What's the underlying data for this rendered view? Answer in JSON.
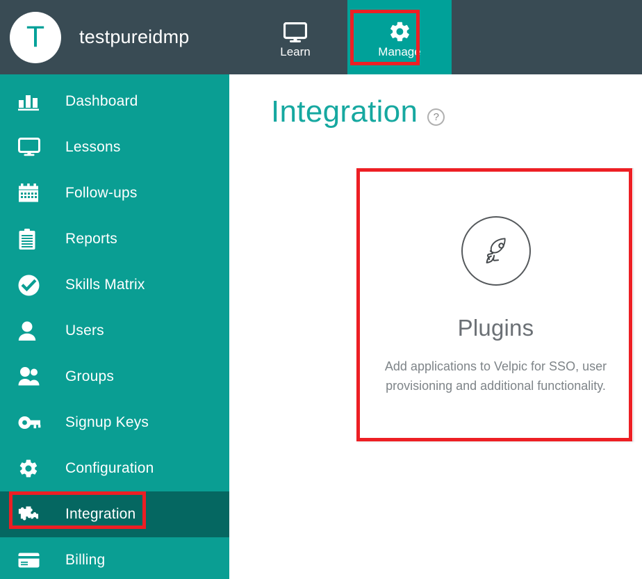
{
  "topbar": {
    "avatar_letter": "T",
    "account_name": "testpureidmp",
    "nav": [
      {
        "label": "Learn",
        "icon": "monitor-icon",
        "active": false
      },
      {
        "label": "Manage",
        "icon": "gear-icon",
        "active": true
      }
    ]
  },
  "sidebar": {
    "items": [
      {
        "label": "Dashboard",
        "icon": "bar-chart-icon",
        "active": false
      },
      {
        "label": "Lessons",
        "icon": "monitor-icon",
        "active": false
      },
      {
        "label": "Follow-ups",
        "icon": "calendar-icon",
        "active": false
      },
      {
        "label": "Reports",
        "icon": "clipboard-icon",
        "active": false
      },
      {
        "label": "Skills Matrix",
        "icon": "check-circle-icon",
        "active": false
      },
      {
        "label": "Users",
        "icon": "user-icon",
        "active": false
      },
      {
        "label": "Groups",
        "icon": "users-icon",
        "active": false
      },
      {
        "label": "Signup Keys",
        "icon": "key-icon",
        "active": false
      },
      {
        "label": "Configuration",
        "icon": "gear-icon",
        "active": false
      },
      {
        "label": "Integration",
        "icon": "puzzle-icon",
        "active": true
      },
      {
        "label": "Billing",
        "icon": "credit-card-icon",
        "active": false
      }
    ]
  },
  "main": {
    "page_title": "Integration",
    "help_icon_label": "?",
    "cards": [
      {
        "icon": "rocket-icon",
        "title": "Plugins",
        "description": "Add applications to Velpic for SSO, user provisioning and additional functionality."
      }
    ]
  },
  "colors": {
    "topbar_bg": "#394b54",
    "sidebar_bg": "#0a9e93",
    "sidebar_active_bg": "#056761",
    "tab_active_bg": "#00a199",
    "accent_teal": "#16a8a0",
    "highlight_red": "#ed1f24",
    "card_text": "#6b7075"
  },
  "highlights": [
    {
      "name": "manage-tab-highlight"
    },
    {
      "name": "integration-nav-highlight"
    },
    {
      "name": "plugins-card-highlight"
    }
  ]
}
